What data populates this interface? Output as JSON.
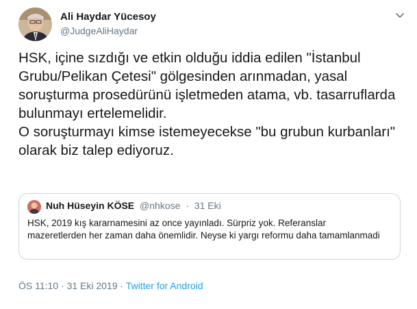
{
  "author": {
    "name": "Ali Haydar Yücesoy",
    "handle": "@JudgeAliHaydar"
  },
  "tweet": {
    "text": "HSK, içine sızdığı ve etkin olduğu iddia edilen \"İstanbul Grubu/Pelikan Çetesi\" gölgesinden arınmadan, yasal soruşturma prosedürünü işletmeden atama, vb. tasarruflarda bulunmayı ertelemelidir.\nO soruşturmayı kimse istemeyecekse \"bu grubun kurbanları\" olarak biz talep ediyoruz."
  },
  "quoted": {
    "name": "Nuh Hüseyin KÖSE",
    "handle": "@nhkose",
    "separator": "·",
    "date": "31 Eki",
    "text": "HSK, 2019 kış kararnamesini az once yayınladı. Sürpriz yok. Referanslar mazeretlerden her zaman daha önemlidir. Neyse ki yargı reformu daha tamamlanmadi"
  },
  "footer": {
    "time": "ÖS 11:10",
    "separator": "·",
    "date": "31 Eki 2019",
    "source": "Twitter for Android"
  },
  "icons": {
    "menu": "chevron-down-icon"
  },
  "colors": {
    "link": "#1da1f2",
    "secondary_text": "#657786",
    "border": "#ccd6dd"
  }
}
